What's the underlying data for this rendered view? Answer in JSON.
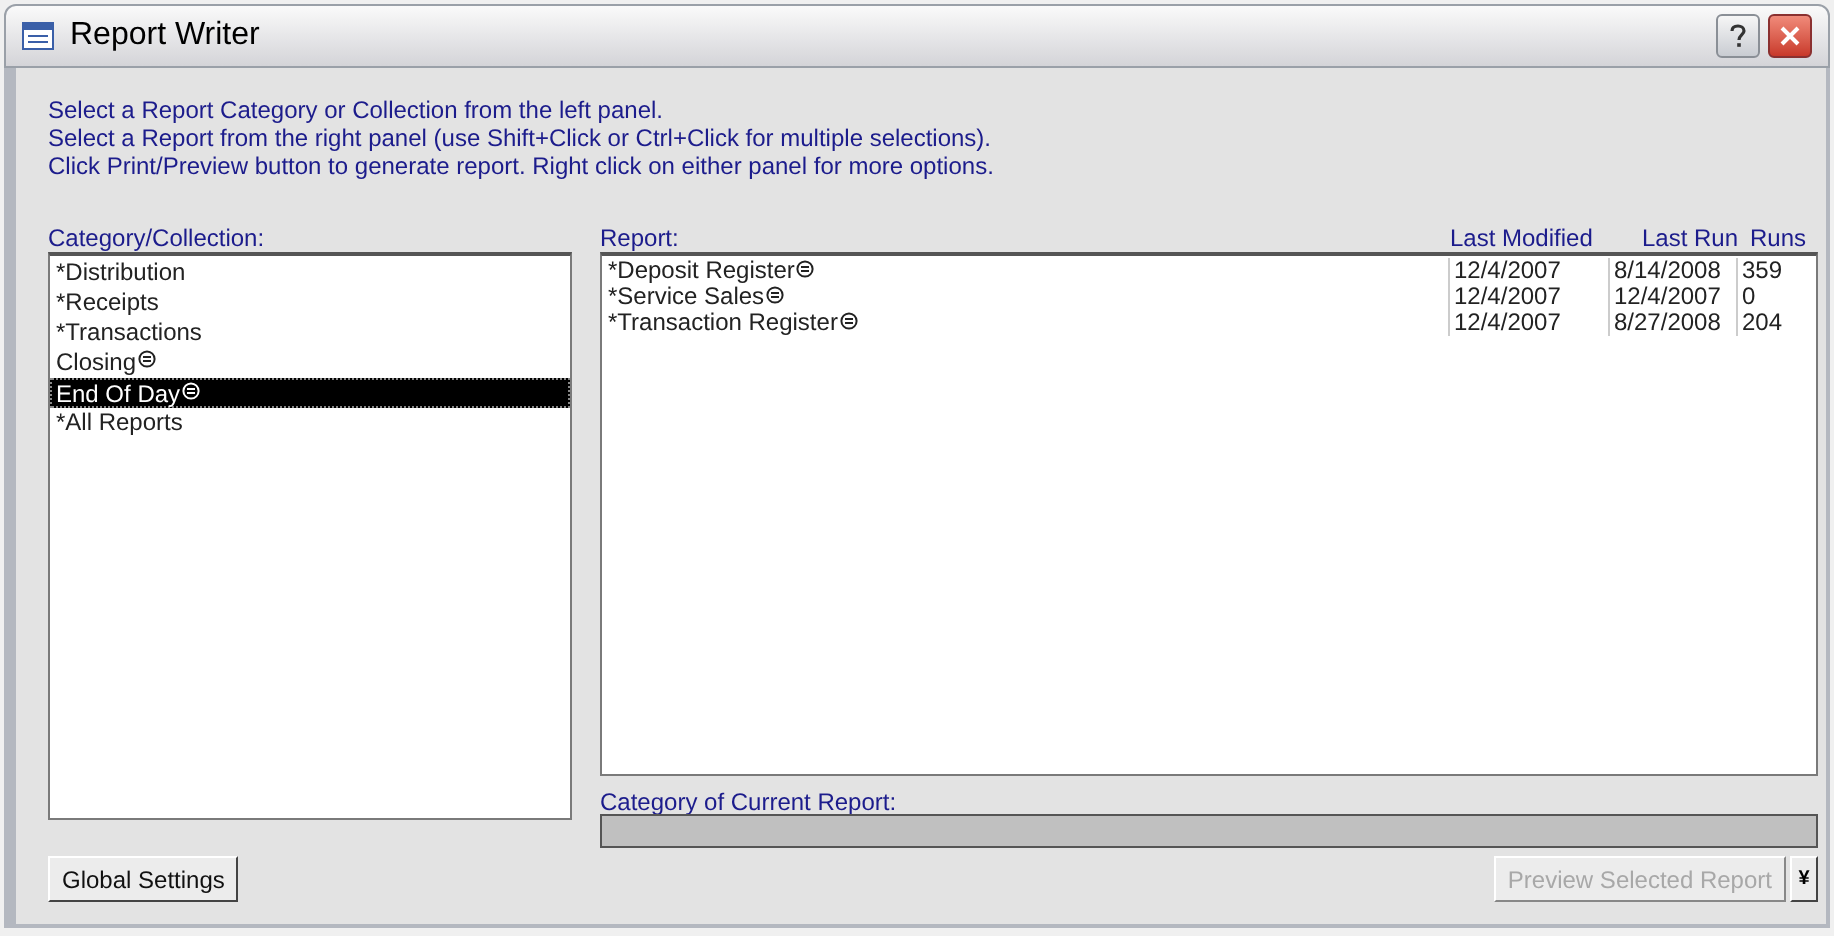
{
  "window": {
    "title": "Report Writer"
  },
  "instructions": [
    "Select a Report Category or Collection from the left panel.",
    "Select a Report from the right panel (use Shift+Click or Ctrl+Click for multiple selections).",
    "Click Print/Preview button to generate report. Right click on either panel for more options."
  ],
  "categories": {
    "label": "Category/Collection:",
    "items": [
      {
        "text": "*Distribution",
        "flagged": false,
        "selected": false
      },
      {
        "text": "*Receipts",
        "flagged": false,
        "selected": false
      },
      {
        "text": "*Transactions",
        "flagged": false,
        "selected": false
      },
      {
        "text": "Closing",
        "flagged": true,
        "selected": false
      },
      {
        "text": "End Of Day",
        "flagged": true,
        "selected": true
      },
      {
        "text": "*All Reports",
        "flagged": false,
        "selected": false
      }
    ]
  },
  "reports": {
    "columns": [
      "Report:",
      "Last Modified",
      "Last Run",
      "Runs"
    ],
    "rows": [
      {
        "name": "*Deposit Register",
        "flagged": true,
        "last_modified": "12/4/2007",
        "last_run": "8/14/2008",
        "runs": "359"
      },
      {
        "name": "*Service Sales",
        "flagged": true,
        "last_modified": "12/4/2007",
        "last_run": "12/4/2007",
        "runs": "0"
      },
      {
        "name": "*Transaction Register",
        "flagged": true,
        "last_modified": "12/4/2007",
        "last_run": "8/27/2008",
        "runs": "204"
      }
    ]
  },
  "current_category": {
    "label": "Category of Current Report:"
  },
  "buttons": {
    "global_settings": "Global Settings",
    "preview": "Preview Selected Report",
    "preview_disabled": true,
    "dropdown": "¥"
  }
}
